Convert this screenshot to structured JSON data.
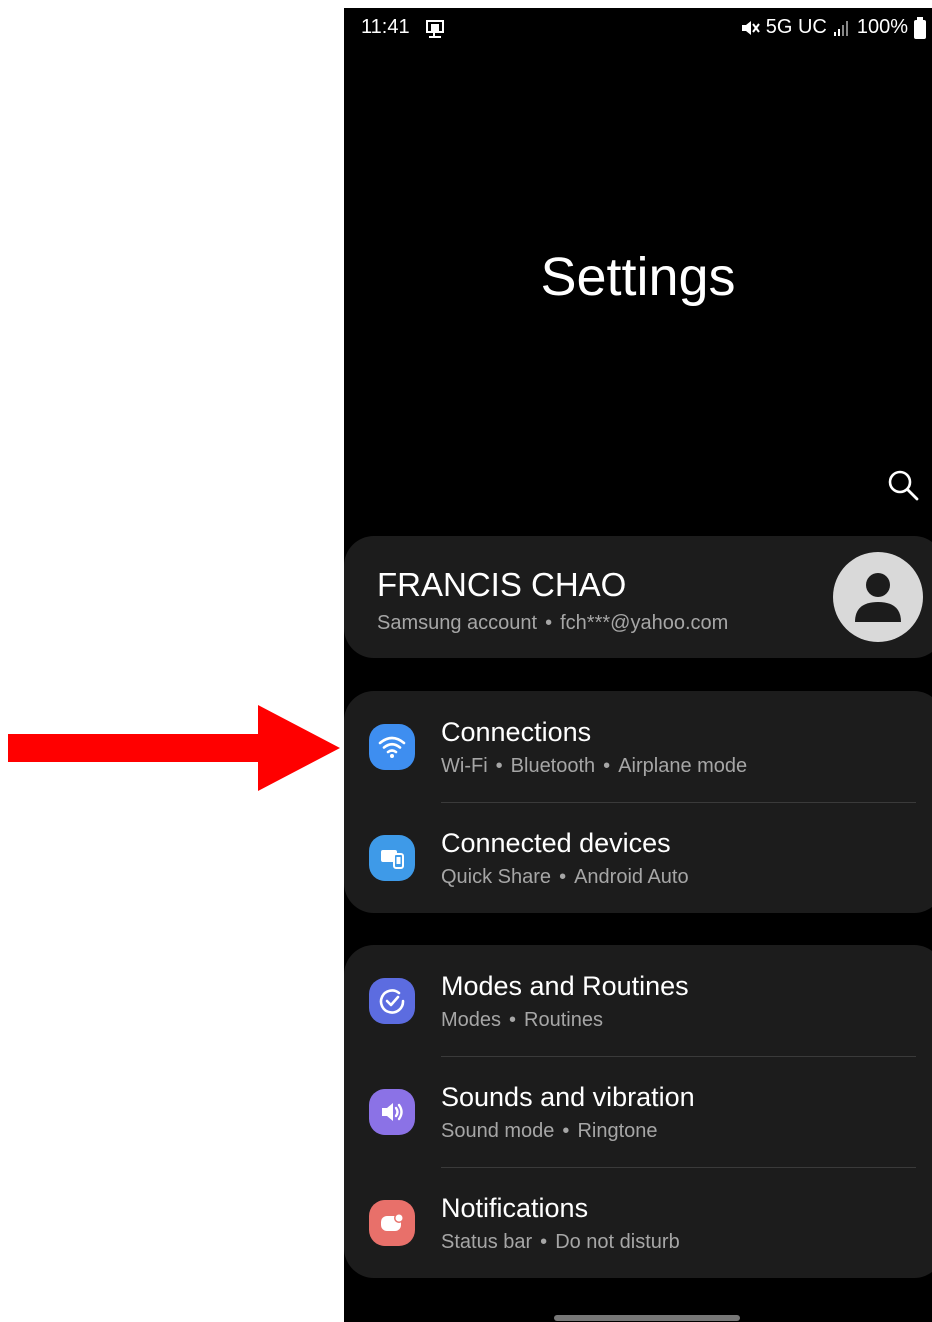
{
  "status_bar": {
    "time": "11:41",
    "network": "5G UC",
    "battery": "100%",
    "icons": [
      "screen-cast-icon",
      "mute-icon",
      "signal-icon",
      "battery-icon"
    ]
  },
  "header": {
    "title": "Settings",
    "search_icon": "search-icon"
  },
  "account": {
    "name": "FRANCIS CHAO",
    "subtitle_left": "Samsung account",
    "subtitle_right": "fch***@yahoo.com",
    "avatar_icon": "person-avatar-icon"
  },
  "groups": [
    {
      "items": [
        {
          "title": "Connections",
          "subs": [
            "Wi-Fi",
            "Bluetooth",
            "Airplane mode"
          ],
          "icon": "wifi-icon",
          "color": "#3e8ef0"
        },
        {
          "title": "Connected devices",
          "subs": [
            "Quick Share",
            "Android Auto"
          ],
          "icon": "connected-devices-icon",
          "color": "#3e9ae8"
        }
      ]
    },
    {
      "items": [
        {
          "title": "Modes and Routines",
          "subs": [
            "Modes",
            "Routines"
          ],
          "icon": "modes-routines-icon",
          "color": "#5c6ce0"
        },
        {
          "title": "Sounds and vibration",
          "subs": [
            "Sound mode",
            "Ringtone"
          ],
          "icon": "speaker-icon",
          "color": "#8b72e6"
        },
        {
          "title": "Notifications",
          "subs": [
            "Status bar",
            "Do not disturb"
          ],
          "icon": "notifications-icon",
          "color": "#e8706a"
        }
      ]
    }
  ],
  "annotation": {
    "type": "arrow",
    "color": "#ff0000",
    "target": "Connections"
  }
}
